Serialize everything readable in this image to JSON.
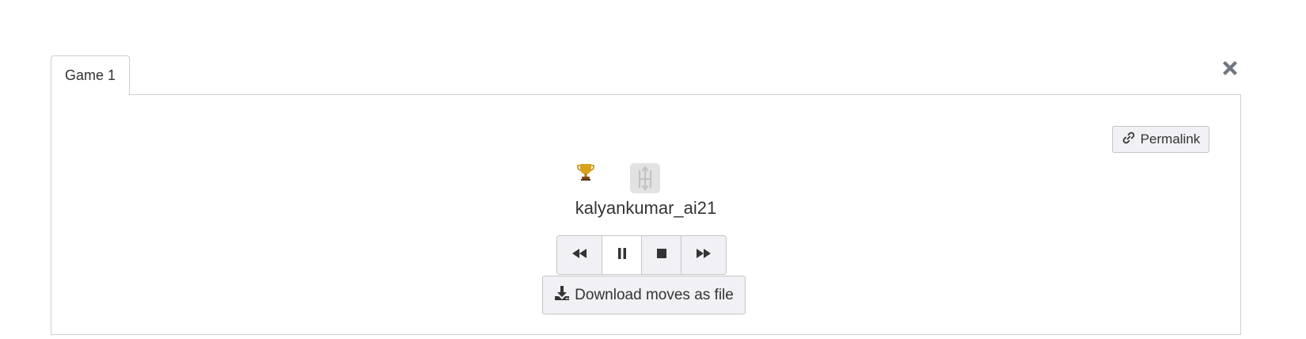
{
  "tabs": [
    {
      "label": "Game 1",
      "active": true
    }
  ],
  "close": {
    "icon": "close-icon"
  },
  "permalink": {
    "label": "Permalink",
    "icon": "link-icon"
  },
  "player": {
    "name": "kalyankumar_ai21",
    "winner_icon": "trophy-icon",
    "type_icon": "hex-player-icon"
  },
  "playback": {
    "buttons": [
      {
        "name": "rewind-button",
        "icon": "fast-backward-icon"
      },
      {
        "name": "pause-button",
        "icon": "pause-icon",
        "active": true
      },
      {
        "name": "stop-button",
        "icon": "stop-icon"
      },
      {
        "name": "fast-forward-button",
        "icon": "fast-forward-icon"
      }
    ]
  },
  "download": {
    "label": "Download moves as file",
    "icon": "download-icon"
  },
  "colors": {
    "border": "#cfcfcf",
    "button_bg": "#f1f1f5",
    "icon_dark": "#333333",
    "close_gray": "#6f7780",
    "badge_bg": "#e2e2e2",
    "trophy_gold": "#d9a21b"
  }
}
